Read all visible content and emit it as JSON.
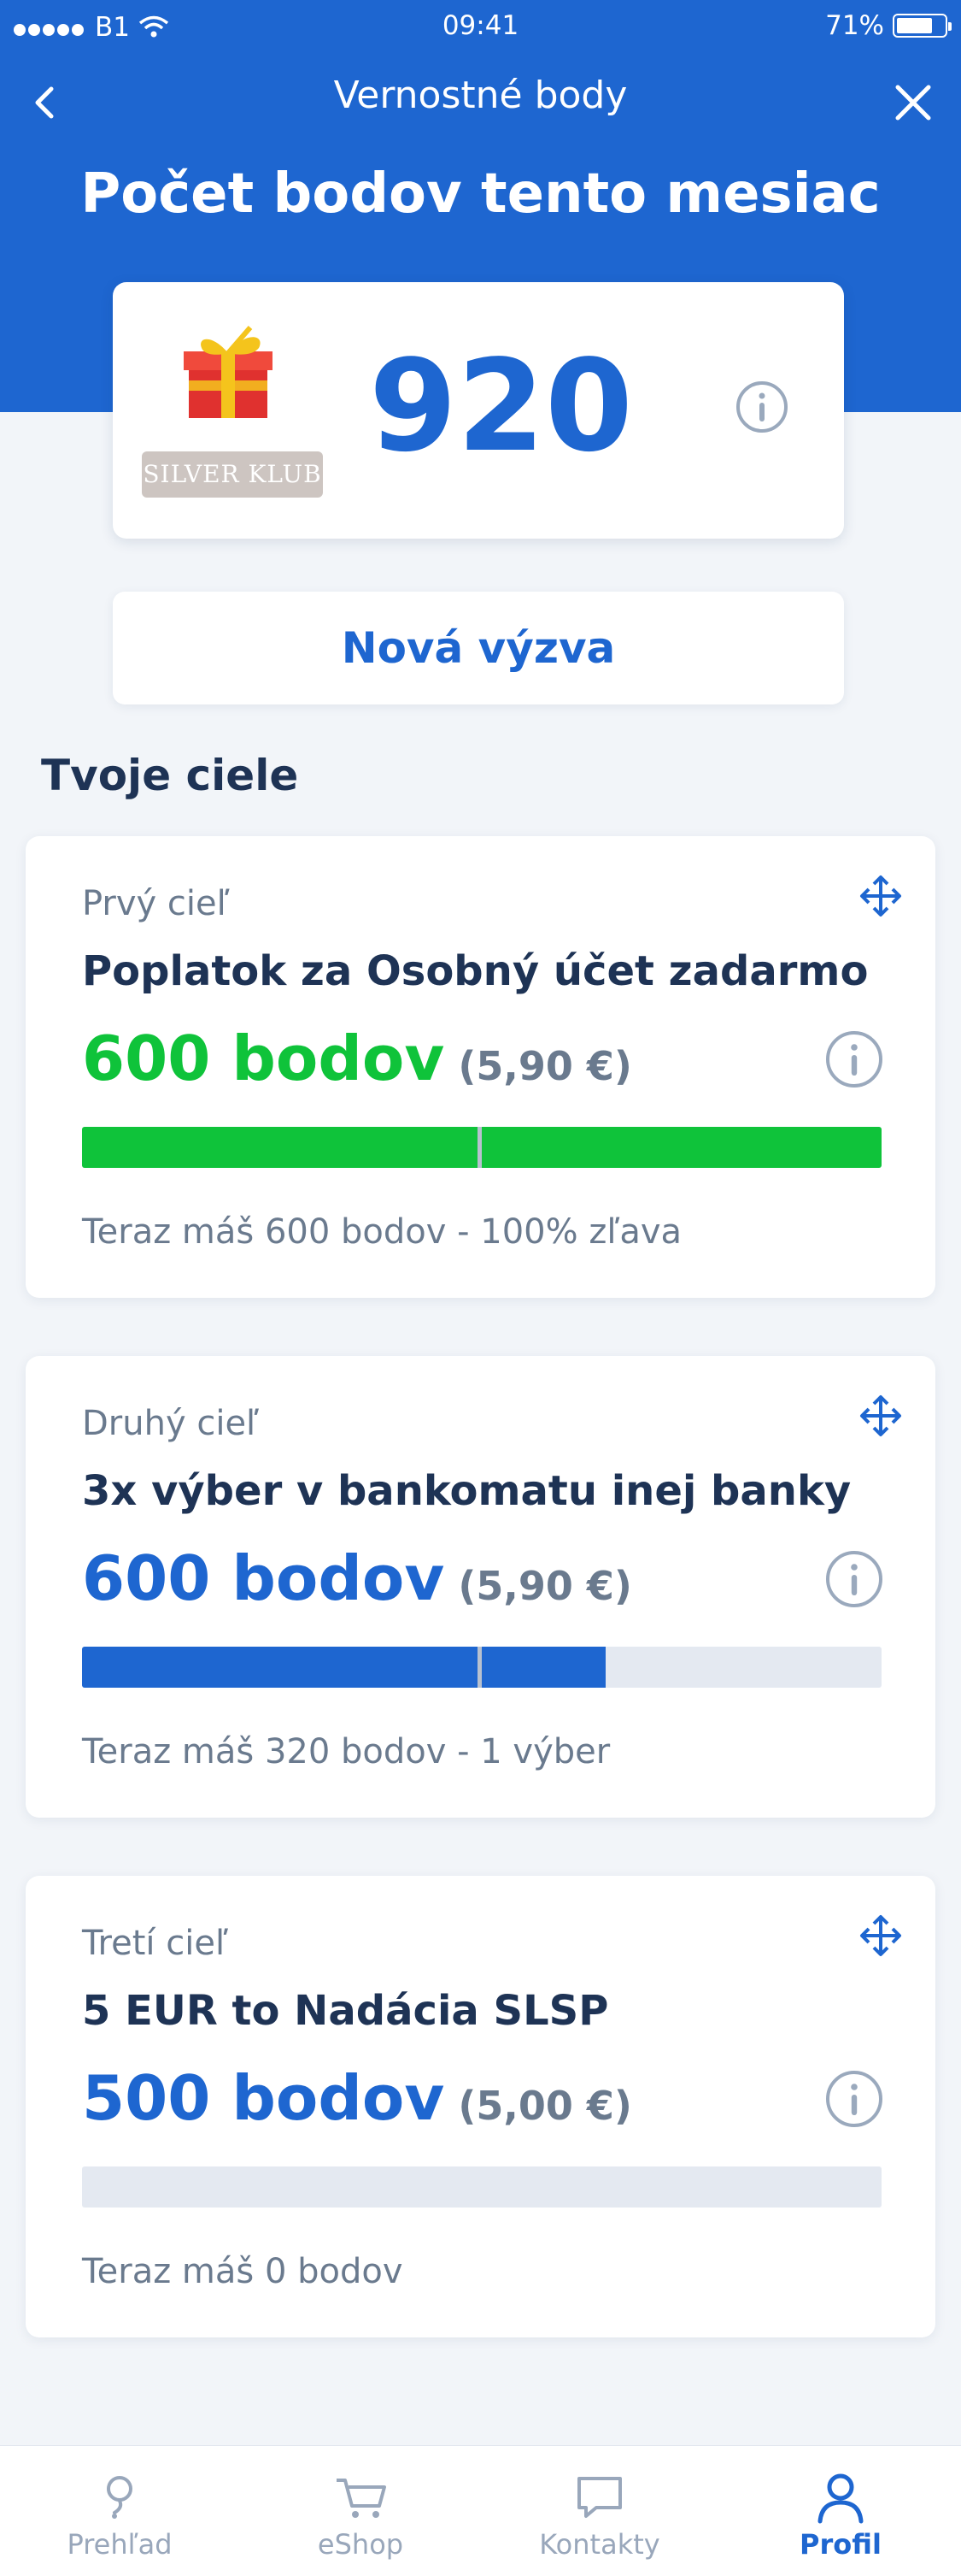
{
  "status_bar": {
    "carrier": "B1",
    "time": "09:41",
    "battery": "71%"
  },
  "header": {
    "title": "Vernostné body",
    "headline": "Počet bodov tento mesiac"
  },
  "points": {
    "value": "920",
    "badge": "SILVER KLUB"
  },
  "new_challenge_label": "Nová výzva",
  "goals_title": "Tvoje ciele",
  "goals": [
    {
      "label": "Prvý cieľ",
      "name": "Poplatok za Osobný účet zadarmo",
      "points": "600 bodov",
      "eur": "(5,90 €)",
      "progress": 1.0,
      "points_color": "#0fc33a",
      "bar_color": "#0fc33a",
      "status": "Teraz máš 600 bodov - 100% zľava"
    },
    {
      "label": "Druhý cieľ",
      "name": "3x výber v bankomatu inej banky",
      "points": "600 bodov",
      "eur": "(5,90 €)",
      "progress": 0.655,
      "points_color": "#1e66d0",
      "bar_color": "#1e66d0",
      "status": "Teraz máš 320 bodov - 1 výber"
    },
    {
      "label": "Tretí cieľ",
      "name": "5 EUR to Nadácia SLSP",
      "points": "500 bodov",
      "eur": "(5,00 €)",
      "progress": 0.0,
      "points_color": "#1e66d0",
      "bar_color": "#1e66d0",
      "status": "Teraz máš 0 bodov"
    }
  ],
  "tabs": [
    {
      "label": "Prehľad",
      "icon": "overview-icon",
      "active": false
    },
    {
      "label": "eShop",
      "icon": "cart-icon",
      "active": false
    },
    {
      "label": "Kontakty",
      "icon": "chat-icon",
      "active": false
    },
    {
      "label": "Profil",
      "icon": "profile-icon",
      "active": true
    }
  ],
  "colors": {
    "brand": "#1e66d0",
    "success": "#0fc33a",
    "background": "#f2f5f9"
  }
}
